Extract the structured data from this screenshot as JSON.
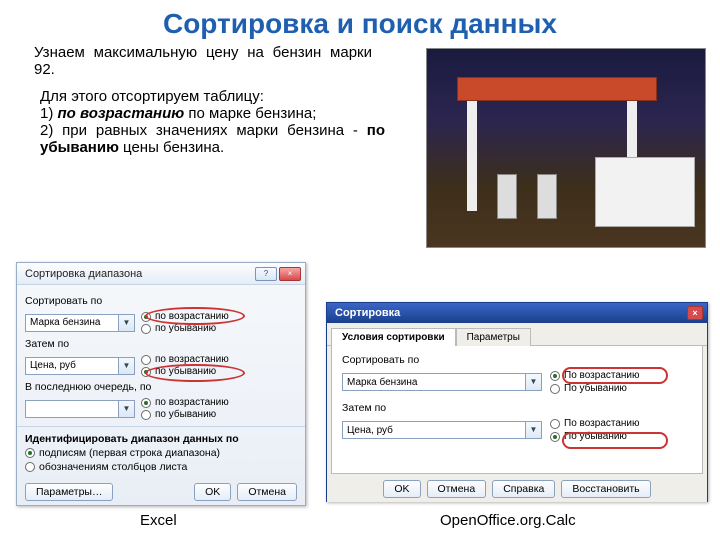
{
  "title": "Сортировка и поиск данных",
  "intro": "Узнаем максимальную цену на бензин марки 92.",
  "para_lead": "Для этого отсортируем таблицу:",
  "para_1_a": "1) ",
  "para_1_em": "по возрастанию",
  "para_1_b": " по марке бензина;",
  "para_2_a": "2) при равных значениях марки бензина - ",
  "para_2_bold": "по убыванию",
  "para_2_b": " цены бензина.",
  "excel": {
    "title": "Сортировка диапазона",
    "sort_by": "Сортировать по",
    "field1": "Марка бензина",
    "then_by": "Затем по",
    "field2": "Цена, руб",
    "last_by": "В последнюю очередь, по",
    "asc": "по возрастанию",
    "desc": "по убыванию",
    "identify": "Идентифицировать диапазон данных по",
    "id_opt1": "подписям (первая строка диапазона)",
    "id_opt2": "обозначениям столбцов листа",
    "params": "Параметры…",
    "ok": "OK",
    "cancel": "Отмена"
  },
  "oo": {
    "title": "Сортировка",
    "tab1": "Условия сортировки",
    "tab2": "Параметры",
    "sort_by": "Сортировать по",
    "field1": "Марка бензина",
    "then_by": "Затем по",
    "field2": "Цена, руб",
    "asc": "По возрастанию",
    "desc": "По убыванию",
    "ok": "OK",
    "cancel": "Отмена",
    "help": "Справка",
    "reset": "Восстановить"
  },
  "captions": {
    "excel": "Excel",
    "oo": "OpenOffice.org.Calc"
  }
}
